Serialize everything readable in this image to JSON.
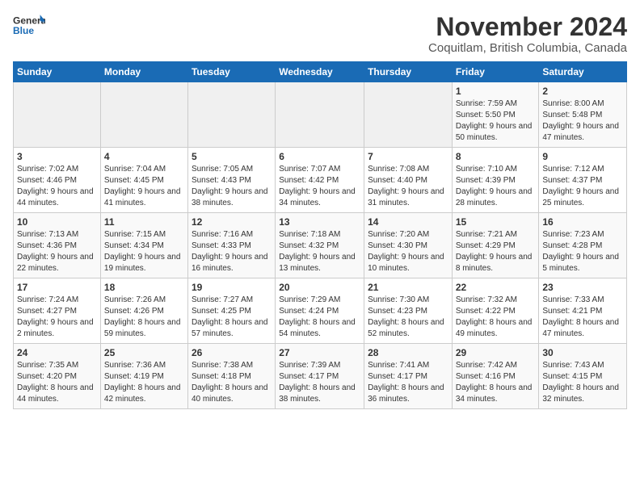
{
  "header": {
    "logo_general": "General",
    "logo_blue": "Blue",
    "title": "November 2024",
    "subtitle": "Coquitlam, British Columbia, Canada"
  },
  "calendar": {
    "days_of_week": [
      "Sunday",
      "Monday",
      "Tuesday",
      "Wednesday",
      "Thursday",
      "Friday",
      "Saturday"
    ],
    "weeks": [
      [
        {
          "day": "",
          "info": ""
        },
        {
          "day": "",
          "info": ""
        },
        {
          "day": "",
          "info": ""
        },
        {
          "day": "",
          "info": ""
        },
        {
          "day": "",
          "info": ""
        },
        {
          "day": "1",
          "info": "Sunrise: 7:59 AM\nSunset: 5:50 PM\nDaylight: 9 hours and 50 minutes."
        },
        {
          "day": "2",
          "info": "Sunrise: 8:00 AM\nSunset: 5:48 PM\nDaylight: 9 hours and 47 minutes."
        }
      ],
      [
        {
          "day": "3",
          "info": "Sunrise: 7:02 AM\nSunset: 4:46 PM\nDaylight: 9 hours and 44 minutes."
        },
        {
          "day": "4",
          "info": "Sunrise: 7:04 AM\nSunset: 4:45 PM\nDaylight: 9 hours and 41 minutes."
        },
        {
          "day": "5",
          "info": "Sunrise: 7:05 AM\nSunset: 4:43 PM\nDaylight: 9 hours and 38 minutes."
        },
        {
          "day": "6",
          "info": "Sunrise: 7:07 AM\nSunset: 4:42 PM\nDaylight: 9 hours and 34 minutes."
        },
        {
          "day": "7",
          "info": "Sunrise: 7:08 AM\nSunset: 4:40 PM\nDaylight: 9 hours and 31 minutes."
        },
        {
          "day": "8",
          "info": "Sunrise: 7:10 AM\nSunset: 4:39 PM\nDaylight: 9 hours and 28 minutes."
        },
        {
          "day": "9",
          "info": "Sunrise: 7:12 AM\nSunset: 4:37 PM\nDaylight: 9 hours and 25 minutes."
        }
      ],
      [
        {
          "day": "10",
          "info": "Sunrise: 7:13 AM\nSunset: 4:36 PM\nDaylight: 9 hours and 22 minutes."
        },
        {
          "day": "11",
          "info": "Sunrise: 7:15 AM\nSunset: 4:34 PM\nDaylight: 9 hours and 19 minutes."
        },
        {
          "day": "12",
          "info": "Sunrise: 7:16 AM\nSunset: 4:33 PM\nDaylight: 9 hours and 16 minutes."
        },
        {
          "day": "13",
          "info": "Sunrise: 7:18 AM\nSunset: 4:32 PM\nDaylight: 9 hours and 13 minutes."
        },
        {
          "day": "14",
          "info": "Sunrise: 7:20 AM\nSunset: 4:30 PM\nDaylight: 9 hours and 10 minutes."
        },
        {
          "day": "15",
          "info": "Sunrise: 7:21 AM\nSunset: 4:29 PM\nDaylight: 9 hours and 8 minutes."
        },
        {
          "day": "16",
          "info": "Sunrise: 7:23 AM\nSunset: 4:28 PM\nDaylight: 9 hours and 5 minutes."
        }
      ],
      [
        {
          "day": "17",
          "info": "Sunrise: 7:24 AM\nSunset: 4:27 PM\nDaylight: 9 hours and 2 minutes."
        },
        {
          "day": "18",
          "info": "Sunrise: 7:26 AM\nSunset: 4:26 PM\nDaylight: 8 hours and 59 minutes."
        },
        {
          "day": "19",
          "info": "Sunrise: 7:27 AM\nSunset: 4:25 PM\nDaylight: 8 hours and 57 minutes."
        },
        {
          "day": "20",
          "info": "Sunrise: 7:29 AM\nSunset: 4:24 PM\nDaylight: 8 hours and 54 minutes."
        },
        {
          "day": "21",
          "info": "Sunrise: 7:30 AM\nSunset: 4:23 PM\nDaylight: 8 hours and 52 minutes."
        },
        {
          "day": "22",
          "info": "Sunrise: 7:32 AM\nSunset: 4:22 PM\nDaylight: 8 hours and 49 minutes."
        },
        {
          "day": "23",
          "info": "Sunrise: 7:33 AM\nSunset: 4:21 PM\nDaylight: 8 hours and 47 minutes."
        }
      ],
      [
        {
          "day": "24",
          "info": "Sunrise: 7:35 AM\nSunset: 4:20 PM\nDaylight: 8 hours and 44 minutes."
        },
        {
          "day": "25",
          "info": "Sunrise: 7:36 AM\nSunset: 4:19 PM\nDaylight: 8 hours and 42 minutes."
        },
        {
          "day": "26",
          "info": "Sunrise: 7:38 AM\nSunset: 4:18 PM\nDaylight: 8 hours and 40 minutes."
        },
        {
          "day": "27",
          "info": "Sunrise: 7:39 AM\nSunset: 4:17 PM\nDaylight: 8 hours and 38 minutes."
        },
        {
          "day": "28",
          "info": "Sunrise: 7:41 AM\nSunset: 4:17 PM\nDaylight: 8 hours and 36 minutes."
        },
        {
          "day": "29",
          "info": "Sunrise: 7:42 AM\nSunset: 4:16 PM\nDaylight: 8 hours and 34 minutes."
        },
        {
          "day": "30",
          "info": "Sunrise: 7:43 AM\nSunset: 4:15 PM\nDaylight: 8 hours and 32 minutes."
        }
      ]
    ]
  }
}
